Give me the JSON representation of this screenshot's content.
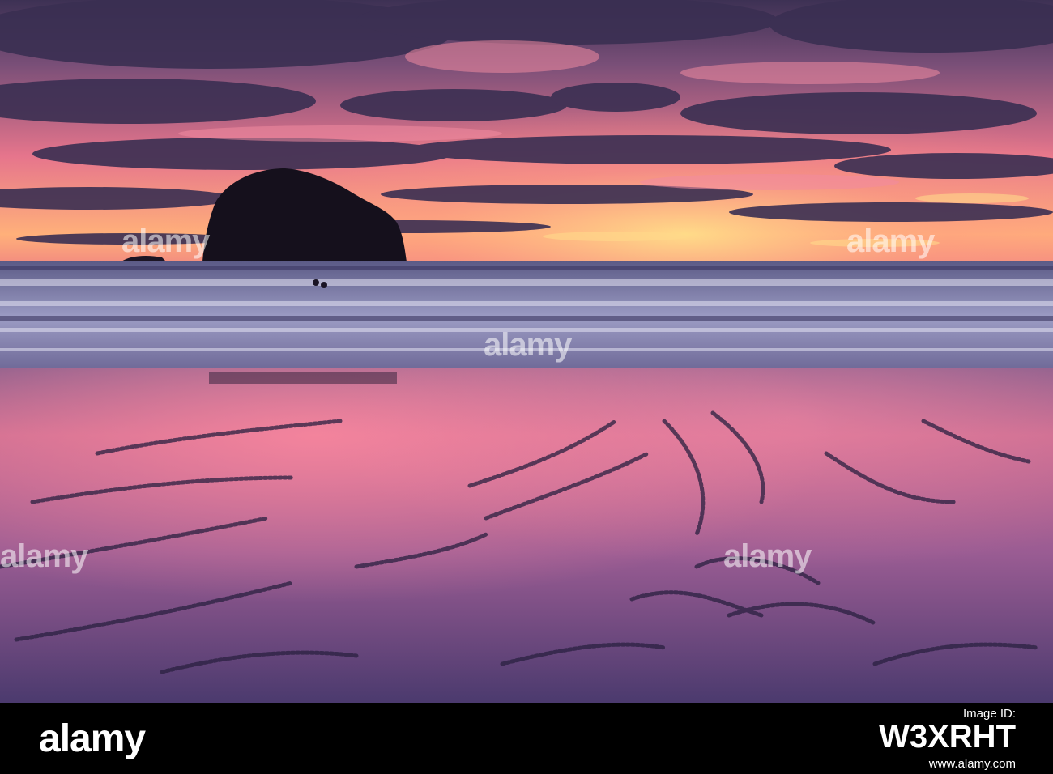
{
  "photo": {
    "subject": "sunset-beach-with-sea-stack",
    "colors": {
      "sky_top": "#4a3a63",
      "sky_glow": "#f27a8f",
      "sun_glow": "#ffd27a",
      "clouds": "#3f3357",
      "rock": "#15101c",
      "sea": "#7c7aa5",
      "wet_sand": "#b5668f",
      "sand_dark": "#3a2c55"
    }
  },
  "watermark": {
    "text": "alamy"
  },
  "footer": {
    "brand": "alamy",
    "image_id_label": "Image ID:",
    "image_id": "W3XRHT",
    "site": "www.alamy.com"
  }
}
